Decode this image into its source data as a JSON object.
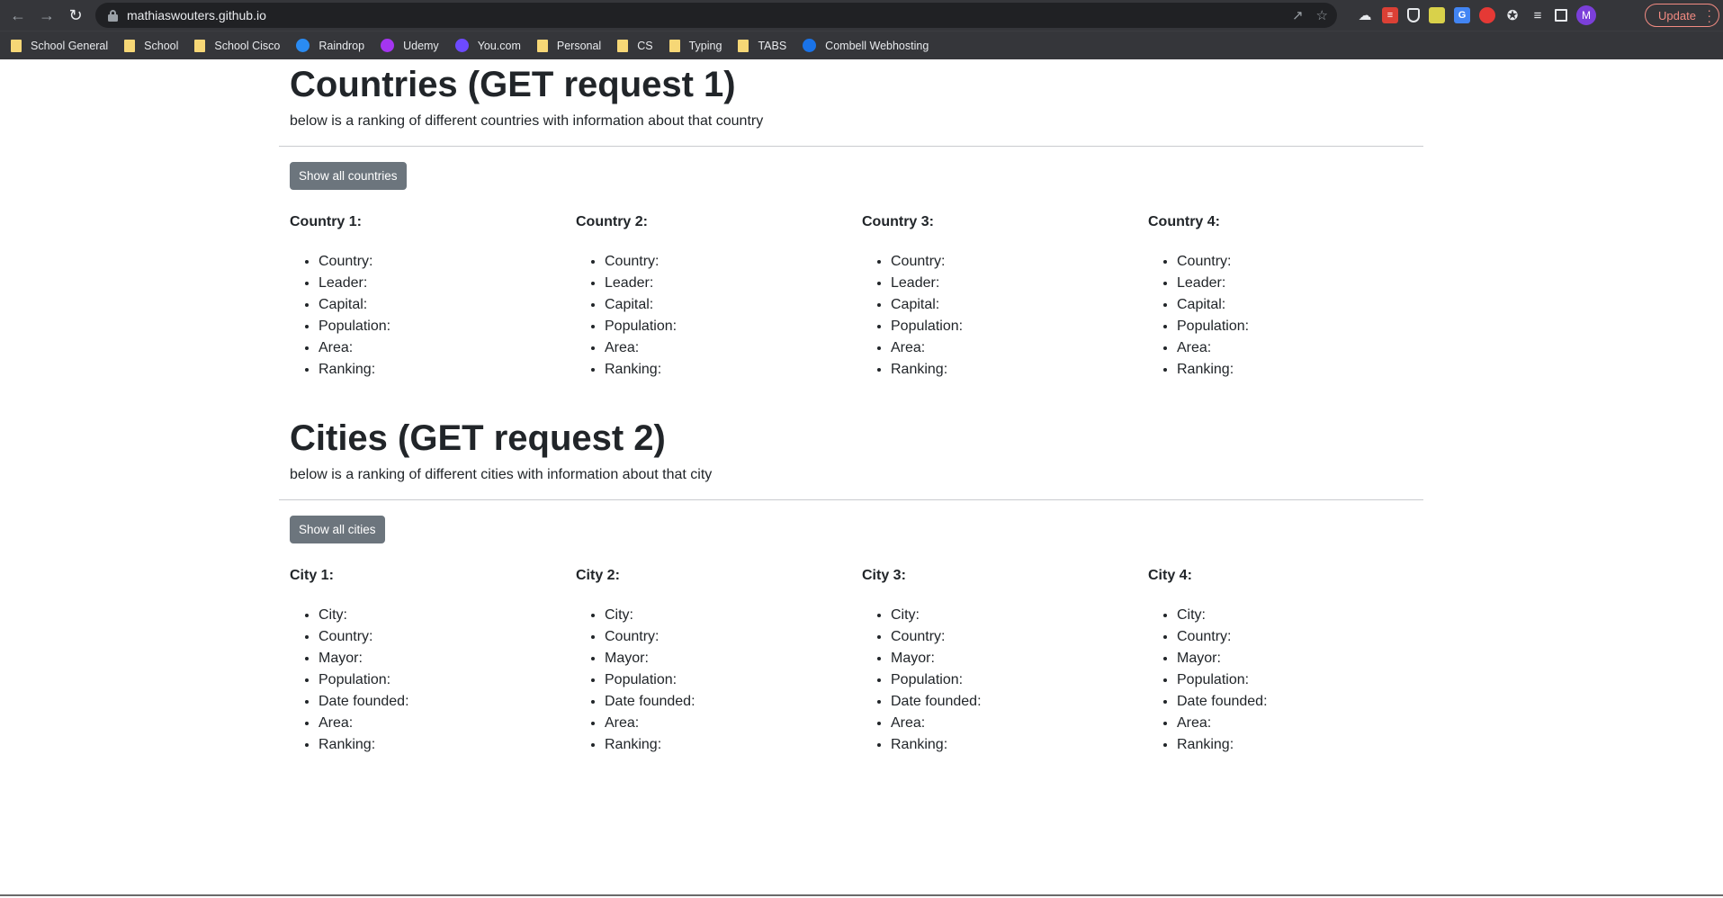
{
  "browser": {
    "url": "mathiaswouters.github.io",
    "update_label": "Update",
    "avatar_letter": "M",
    "bookmarks": [
      {
        "label": "School General",
        "icon": "folder-icon",
        "color": "#f6d776"
      },
      {
        "label": "School",
        "icon": "folder-icon",
        "color": "#f6d776"
      },
      {
        "label": "School Cisco",
        "icon": "folder-icon",
        "color": "#f6d776"
      },
      {
        "label": "Raindrop",
        "icon": "raindrop-icon",
        "color": "#2a8bf2"
      },
      {
        "label": "Udemy",
        "icon": "udemy-icon",
        "color": "#a435f0"
      },
      {
        "label": "You.com",
        "icon": "you-icon",
        "color": "#6d4aff"
      },
      {
        "label": "Personal",
        "icon": "folder-icon",
        "color": "#f6d776"
      },
      {
        "label": "CS",
        "icon": "folder-icon",
        "color": "#f6d776"
      },
      {
        "label": "Typing",
        "icon": "folder-icon",
        "color": "#f6d776"
      },
      {
        "label": "TABS",
        "icon": "folder-icon",
        "color": "#f6d776"
      },
      {
        "label": "Combell Webhosting",
        "icon": "combell-icon",
        "color": "#1a73e8"
      }
    ]
  },
  "countries": {
    "title": "Countries (GET request 1)",
    "lead": "below is a ranking of different countries with information about that country",
    "button_label": "Show all countries",
    "cards": [
      {
        "title": "Country 1:",
        "fields": [
          "Country:",
          "Leader:",
          "Capital:",
          "Population:",
          "Area:",
          "Ranking:"
        ]
      },
      {
        "title": "Country 2:",
        "fields": [
          "Country:",
          "Leader:",
          "Capital:",
          "Population:",
          "Area:",
          "Ranking:"
        ]
      },
      {
        "title": "Country 3:",
        "fields": [
          "Country:",
          "Leader:",
          "Capital:",
          "Population:",
          "Area:",
          "Ranking:"
        ]
      },
      {
        "title": "Country 4:",
        "fields": [
          "Country:",
          "Leader:",
          "Capital:",
          "Population:",
          "Area:",
          "Ranking:"
        ]
      }
    ]
  },
  "cities": {
    "title": "Cities (GET request 2)",
    "lead": "below is a ranking of different cities with information about that city",
    "button_label": "Show all cities",
    "cards": [
      {
        "title": "City 1:",
        "fields": [
          "City:",
          "Country:",
          "Mayor:",
          "Population:",
          "Date founded:",
          "Area:",
          "Ranking:"
        ]
      },
      {
        "title": "City 2:",
        "fields": [
          "City:",
          "Country:",
          "Mayor:",
          "Population:",
          "Date founded:",
          "Area:",
          "Ranking:"
        ]
      },
      {
        "title": "City 3:",
        "fields": [
          "City:",
          "Country:",
          "Mayor:",
          "Population:",
          "Date founded:",
          "Area:",
          "Ranking:"
        ]
      },
      {
        "title": "City 4:",
        "fields": [
          "City:",
          "Country:",
          "Mayor:",
          "Population:",
          "Date founded:",
          "Area:",
          "Ranking:"
        ]
      }
    ]
  }
}
